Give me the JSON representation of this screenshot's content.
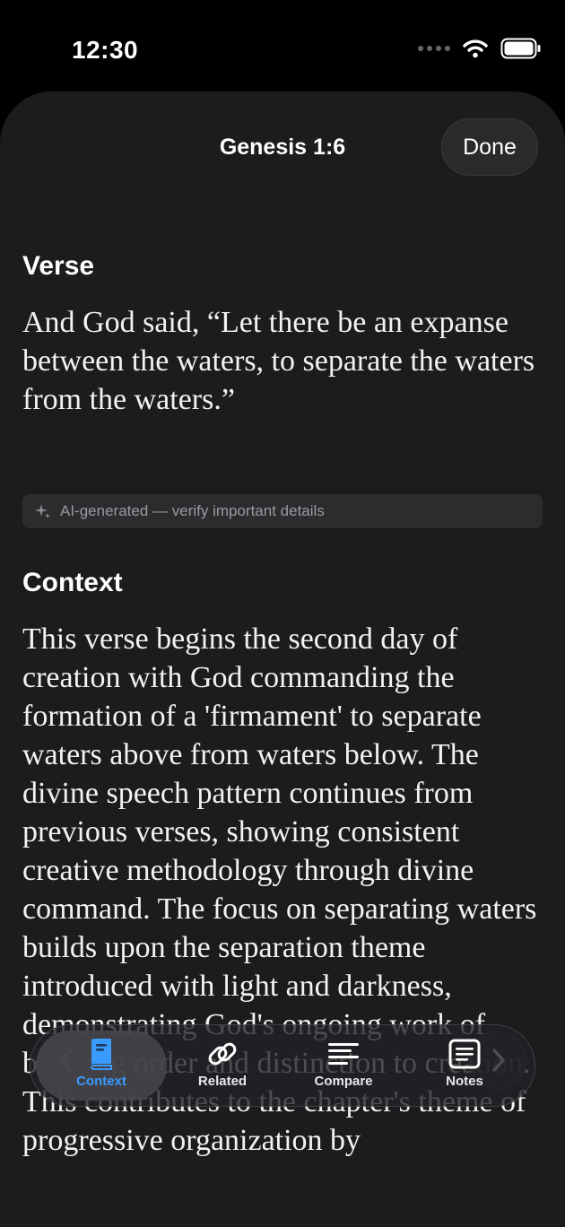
{
  "status_bar": {
    "time": "12:30"
  },
  "header": {
    "title": "Genesis 1:6",
    "done_label": "Done"
  },
  "verse_section": {
    "heading": "Verse",
    "text": "And God said, “Let there be an expanse between the waters, to separate the waters from the waters.”"
  },
  "ai_notice": {
    "text": "AI-generated — verify important details"
  },
  "context_section": {
    "heading": "Context",
    "text": "This verse begins the second day of creation with God commanding the formation of a 'firmament' to separate waters above from waters below. The divine speech pattern continues from previous verses, showing consistent creative methodology through divine command. The focus on separating waters builds upon the separation theme introduced with light and darkness, demonstrating God's ongoing work of bringing order and distinction to creation. This contributes to the chapter's theme of progressive organization by"
  },
  "tabs": [
    {
      "label": "Context",
      "icon": "book-icon",
      "active": true
    },
    {
      "label": "Related",
      "icon": "link-icon",
      "active": false
    },
    {
      "label": "Compare",
      "icon": "lines-icon",
      "active": false
    },
    {
      "label": "Notes",
      "icon": "note-icon",
      "active": false
    }
  ],
  "colors": {
    "accent": "#3a9bff",
    "sheet_background": "#1c1c1e",
    "banner_background": "#2c2c2e"
  }
}
